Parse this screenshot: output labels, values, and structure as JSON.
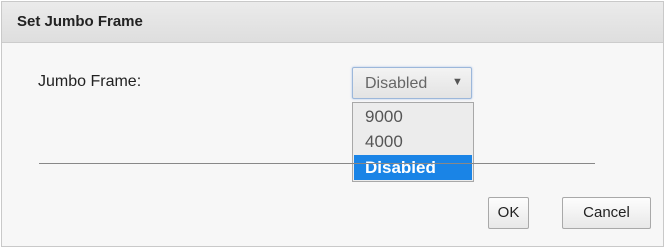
{
  "dialog": {
    "title": "Set Jumbo Frame",
    "field_label": "Jumbo Frame:",
    "select": {
      "value": "Disabled",
      "arrow_icon": "triangle-down-icon",
      "options": [
        "9000",
        "4000",
        "Disabled"
      ],
      "selected_index": 2
    },
    "buttons": {
      "ok": "OK",
      "cancel": "Cancel"
    },
    "colors": {
      "selected_option_bg": "#1a84e6",
      "titlebar_bg": "#e4e4e4",
      "dialog_bg": "#f7f7f7"
    }
  }
}
